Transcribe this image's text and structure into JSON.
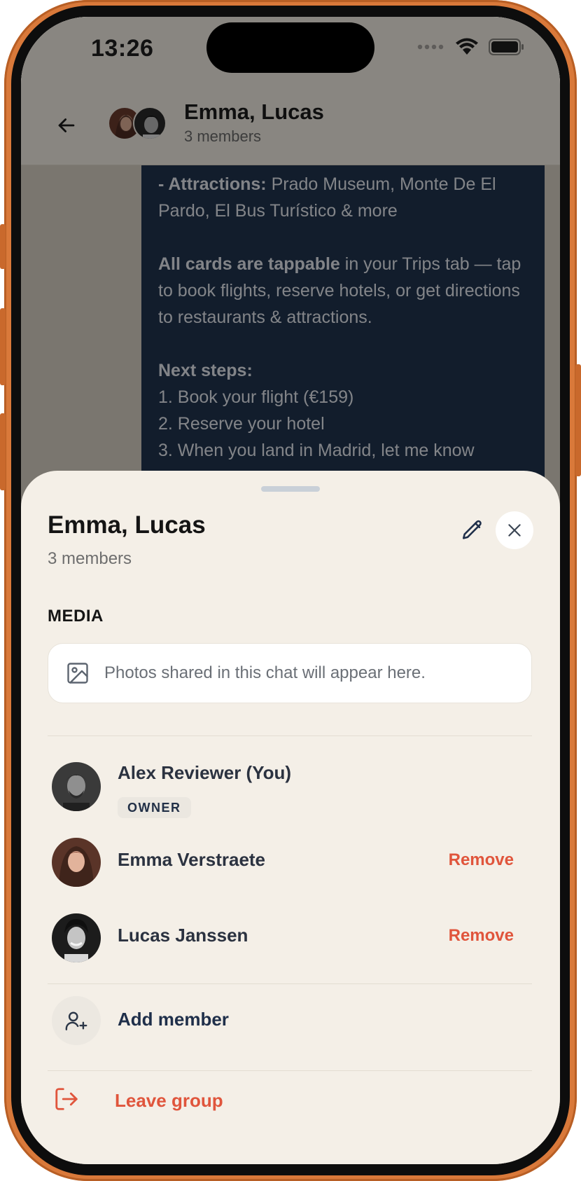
{
  "status_bar": {
    "time": "13:26",
    "icons": [
      "signal-dots-icon",
      "wifi-icon",
      "battery-icon"
    ]
  },
  "chat": {
    "header": {
      "title": "Emma, Lucas",
      "subtitle": "3 members"
    },
    "message": {
      "attractions_label": "- Attractions:",
      "attractions_text": " Prado Museum, Monte De El Pardo, El Bus Turístico & more",
      "cards_label": "All cards are tappable",
      "cards_text": " in your Trips tab — tap to book flights, reserve hotels, or get directions to restaurants & attractions.",
      "next_label": "Next steps:",
      "step1": "1. Book your flight (€159)",
      "step2": "2. Reserve your hotel",
      "step3": "3. When you land in Madrid, let me know"
    }
  },
  "sheet": {
    "title": "Emma, Lucas",
    "subtitle": "3 members",
    "media_label": "MEDIA",
    "media_placeholder": "Photos shared in this chat will appear here.",
    "members": [
      {
        "name": "Alex Reviewer (You)",
        "badge": "OWNER"
      },
      {
        "name": "Emma Verstraete",
        "action": "Remove"
      },
      {
        "name": "Lucas Janssen",
        "action": "Remove"
      }
    ],
    "add_member": "Add member",
    "leave_group": "Leave group"
  },
  "colors": {
    "accent_danger": "#e0553c",
    "bubble": "#20344f",
    "sheet_bg": "#f4efe7",
    "frame": "#d9793a"
  }
}
